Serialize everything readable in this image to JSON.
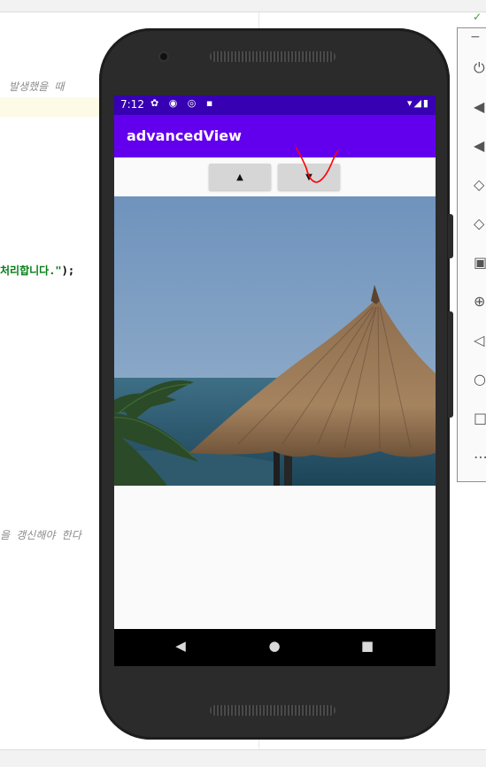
{
  "ide": {
    "code_comment_1": "발생했을 때",
    "code_string": "처리합니다.\"",
    "code_punct": ");",
    "code_comment_2": "을 갱신해야 한다",
    "check_mark": "✓"
  },
  "emulator_toolbar": {
    "minimize": "−",
    "tools": [
      "power-icon",
      "volume-up-icon",
      "volume-down-icon",
      "rotate-left-icon",
      "rotate-right-icon",
      "screenshot-icon",
      "zoom-icon",
      "back-icon",
      "home-icon",
      "overview-icon",
      "more-icon"
    ]
  },
  "status_bar": {
    "time": "7:12",
    "icons": "✿ ◉ ◎ ▪",
    "right_icons": "▾◢▮"
  },
  "app": {
    "title": "advancedView",
    "up_button": "▲",
    "down_button": "▼"
  },
  "navigation": {
    "back": "◀",
    "home": "●",
    "recents": "■"
  },
  "colors": {
    "status_bar": "#3700b3",
    "app_bar": "#6200ee",
    "button": "#d6d6d6",
    "annotation_stroke": "#ff0000"
  }
}
